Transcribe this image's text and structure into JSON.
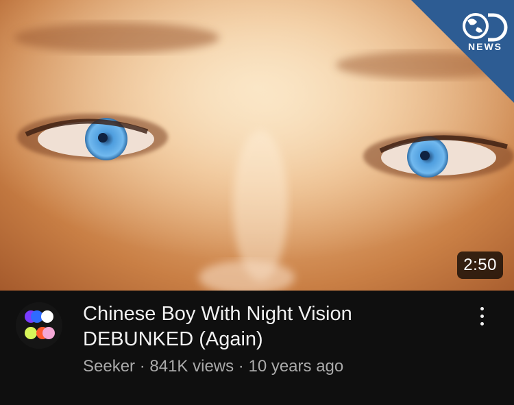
{
  "video": {
    "title": "Chinese Boy With Night Vision DEBUNKED (Again)",
    "channel": "Seeker",
    "views": "841K views",
    "age": "10 years ago",
    "separator": "·",
    "duration": "2:50"
  },
  "badge": {
    "label": "NEWS",
    "icon": "discovery-globe-logo",
    "color": "#2d5c93"
  },
  "avatar": {
    "icon": "seeker-channel-logo",
    "colors": [
      "#7a3cff",
      "#2f6bff",
      "#ffffff",
      "#d7f55a",
      "#ff5a2e",
      "#f4a8d6"
    ]
  },
  "menu": {
    "icon": "more-vertical-icon"
  },
  "colors": {
    "background": "#0f0f0f",
    "title": "#f1f1f1",
    "secondary": "#aaaaaa",
    "eye": "#5aa9e6"
  }
}
